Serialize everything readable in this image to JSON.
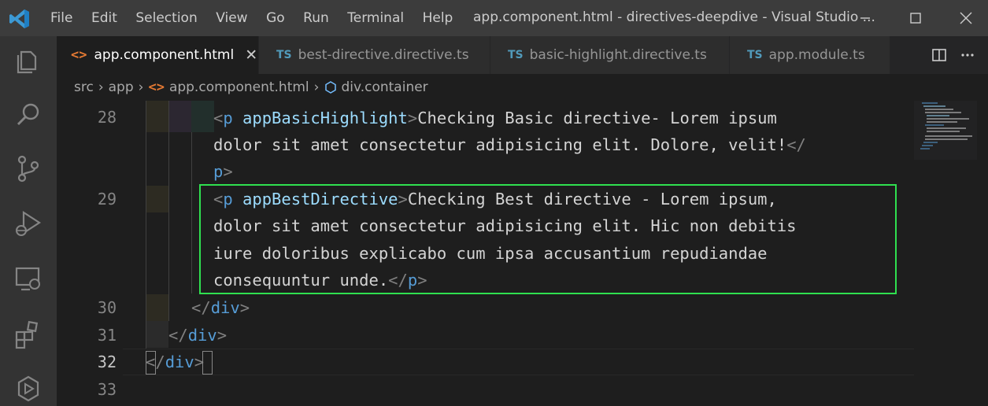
{
  "menu": [
    "File",
    "Edit",
    "Selection",
    "View",
    "Go",
    "Run",
    "Terminal",
    "Help"
  ],
  "window_title": "app.component.html - directives-deepdive - Visual Studio ...",
  "tabs": [
    {
      "label": "app.component.html",
      "type": "html",
      "active": true,
      "close": "✕"
    },
    {
      "label": "best-directive.directive.ts",
      "type": "ts",
      "active": false
    },
    {
      "label": "basic-highlight.directive.ts",
      "type": "ts",
      "active": false
    },
    {
      "label": "app.module.ts",
      "type": "ts",
      "active": false
    }
  ],
  "ts_icon": "TS",
  "html_icon": "<>",
  "breadcrumb": {
    "parts": [
      "src",
      "app",
      "app.component.html",
      "div.container"
    ]
  },
  "lines": {
    "28": "28",
    "29": "29",
    "30": "30",
    "31": "31",
    "32": "32",
    "33": "33"
  },
  "code": {
    "l28a_open": "<",
    "l28a_tag": "p",
    "l28a_attr": "appBasicHighlight",
    "l28a_close": ">",
    "l28a_text": "Checking Basic directive- Lorem ipsum",
    "l28b_text": "dolor sit amet consectetur adipisicing elit. Dolore, velit!",
    "l28b_open": "</",
    "l28c_tag": "p",
    "l28c_close": ">",
    "l29a_open": "<",
    "l29a_tag": "p",
    "l29a_attr": "appBestDirective",
    "l29a_close": ">",
    "l29a_text": "Checking Best directive - Lorem ipsum,",
    "l29b_text": "dolor sit amet consectetur adipisicing elit. Hic non debitis",
    "l29c_text": "iure doloribus explicabo cum ipsa accusantium repudiandae",
    "l29d_text": "consequuntur unde.",
    "l29d_open": "</",
    "l29d_tag": "p",
    "l29d_close": ">",
    "l30_open": "</",
    "l30_tag": "div",
    "l30_close": ">",
    "l31_open": "</",
    "l31_tag": "div",
    "l31_close": ">",
    "l32_open": "</",
    "l32_tag": "div",
    "l32_close": ">"
  },
  "colors": {
    "highlight_border": "#2fe04f",
    "tag_name": "#569cd6",
    "attribute": "#9cdcfe",
    "text": "#d4d4d4",
    "bracket": "#808080"
  }
}
